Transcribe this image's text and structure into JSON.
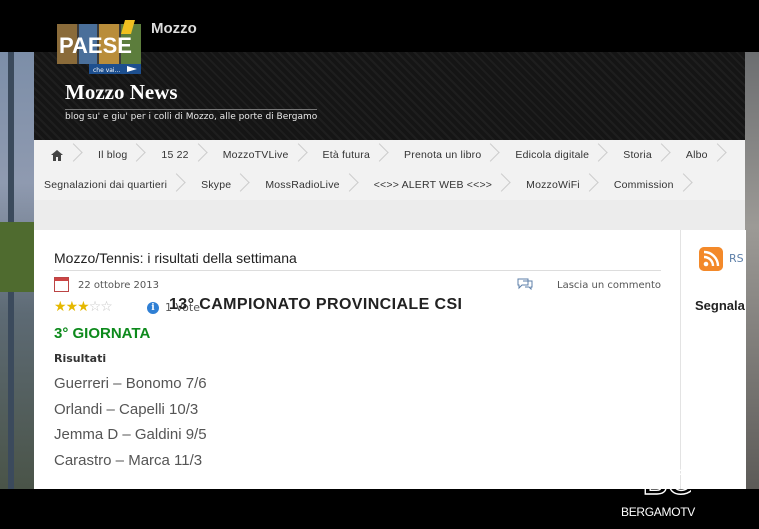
{
  "top": {
    "logo_text": "PAESE",
    "logo_subtext": "che vai...",
    "title": "Mozzo"
  },
  "site": {
    "title": "Mozzo News",
    "description": "blog su' e giu' per i colli di Mozzo, alle porte di Bergamo"
  },
  "nav": {
    "row1": [
      "Il blog",
      "15 22",
      "MozzoTVLive",
      "Età futura",
      "Prenota un libro",
      "Edicola digitale",
      "Storia",
      "Albo"
    ],
    "row2": [
      "Segnalazioni dai quartieri",
      "Skype",
      "MossRadioLive",
      "<<>> ALERT WEB <<>>",
      "MozzoWiFi",
      "Commission"
    ]
  },
  "post": {
    "title": "Mozzo/Tennis: i risultati della settimana",
    "date": "22 ottobre 2013",
    "comment_link": "Lascia un commento",
    "rating_value": 3,
    "rating_max": 5,
    "votes": "1 Vote",
    "championship": "13° CAMPIONATO PROVINCIALE CSI",
    "round": "3° GIORNATA",
    "results_heading": "Risultati",
    "results": [
      "Guerreri – Bonomo 7/6",
      "Orlandi – Capelli 10/3",
      "Jemma D – Galdini 9/5",
      "Carastro – Marca 11/3"
    ]
  },
  "sidebar": {
    "rss_label": "RS",
    "widget_title": "Segnala"
  },
  "broadcaster": {
    "mark": "BG",
    "name": "BERGAMOTV"
  },
  "colors": {
    "round_green": "#0d8a1c",
    "rss_orange": "#f3892a",
    "star_gold": "#e5b800",
    "header_dark": "#151515"
  }
}
